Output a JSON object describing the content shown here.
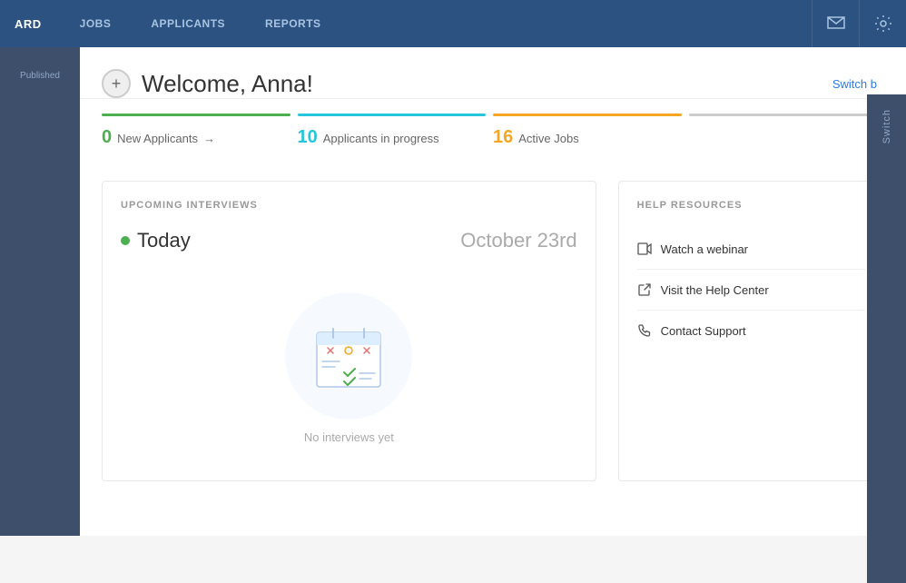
{
  "nav": {
    "brand": "ARD",
    "items": [
      {
        "id": "jobs",
        "label": "JOBS",
        "active": false
      },
      {
        "id": "applicants",
        "label": "APPLICANTS",
        "active": false
      },
      {
        "id": "reports",
        "label": "REPORTS",
        "active": false
      }
    ]
  },
  "header": {
    "welcome": "Welcome, Anna!",
    "plus_label": "+",
    "switch_label": "Switch b"
  },
  "stats": [
    {
      "id": "new-applicants",
      "number": "0",
      "label": "New Applicants",
      "has_arrow": true,
      "color": "#4caf50",
      "number_color": "#4caf50"
    },
    {
      "id": "applicants-in-progress",
      "number": "10",
      "label": "Applicants in progress",
      "has_arrow": false,
      "color": "#26c6da",
      "number_color": "#26c6da"
    },
    {
      "id": "active-jobs",
      "number": "16",
      "label": "Active Jobs",
      "has_arrow": false,
      "color": "#f5a623",
      "number_color": "#f5a623"
    },
    {
      "id": "other",
      "number": "",
      "label": "",
      "has_arrow": false,
      "color": "#ccc",
      "number_color": "#999"
    }
  ],
  "interviews": {
    "section_title": "UPCOMING INTERVIEWS",
    "today_label": "Today",
    "date": "October 23rd",
    "no_interviews": "No interviews yet"
  },
  "help": {
    "section_title": "HELP RESOURCES",
    "items": [
      {
        "id": "webinar",
        "label": "Watch a webinar",
        "icon": "video"
      },
      {
        "id": "help-center",
        "label": "Visit the Help Center",
        "icon": "external"
      },
      {
        "id": "support",
        "label": "Contact Support",
        "icon": "phone"
      }
    ]
  },
  "sidebar": {
    "items": [
      {
        "id": "published",
        "label": "Published",
        "active": false
      }
    ]
  },
  "switch_panel": {
    "label": "Switch"
  }
}
